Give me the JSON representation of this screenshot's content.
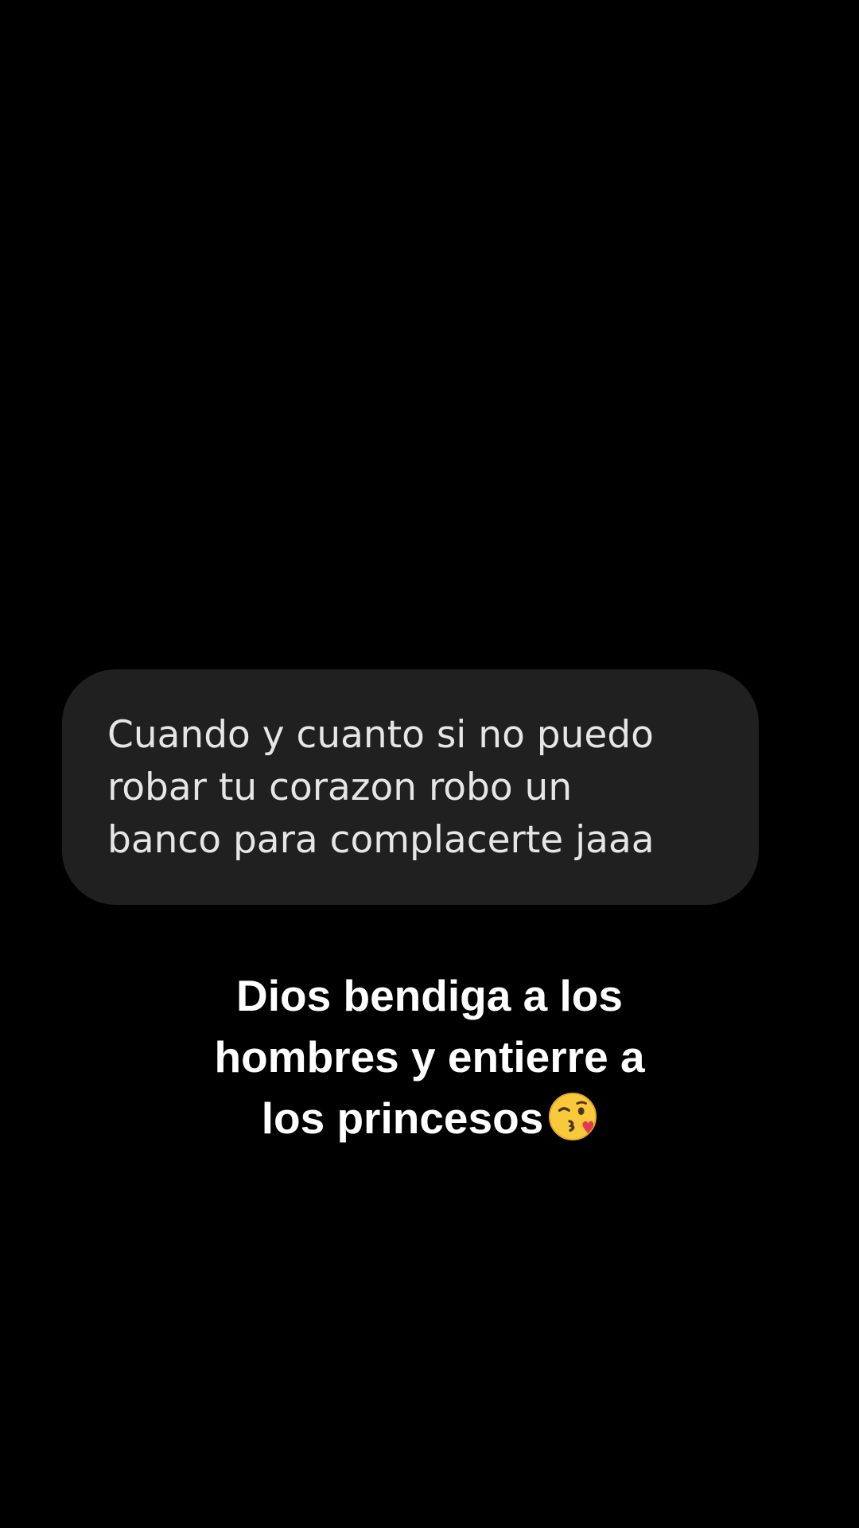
{
  "message": {
    "text": "Cuando y cuanto si no puedo\nrobar tu corazon robo un\nbanco para complacerte jaaa"
  },
  "caption": {
    "text": "Dios bendiga a los\nhombres y entierre a\nlos princesos",
    "emoji": "kissing-face-with-heart-icon"
  },
  "colors": {
    "background": "#000000",
    "bubble": "#202020",
    "bubble_text": "#e6e6e6",
    "caption_text": "#ffffff"
  }
}
